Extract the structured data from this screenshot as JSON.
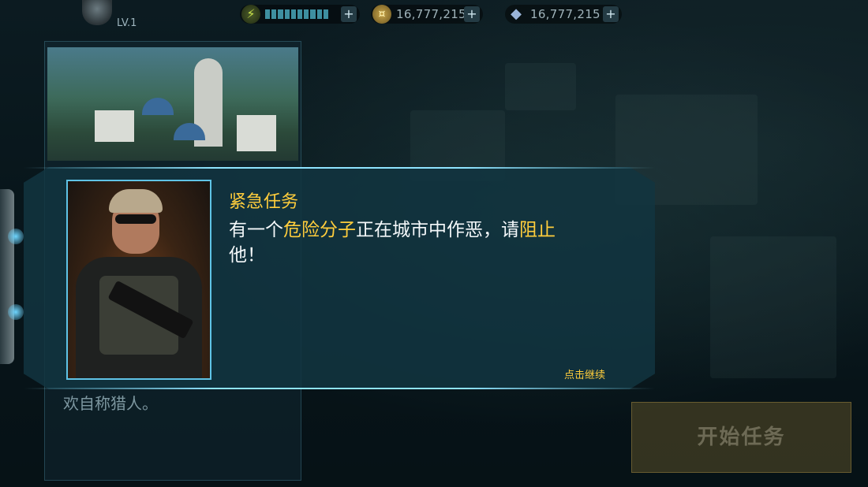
{
  "header": {
    "level": "LV.1",
    "energy_segments": 10,
    "coins": "16,777,215",
    "gems": "16,777,215",
    "icons": {
      "energy": "lightning-icon",
      "coins": "coin-icon",
      "gems": "diamond-icon",
      "add": "plus-icon"
    }
  },
  "story": {
    "last_line": "欢自称猎人。"
  },
  "dialog": {
    "title": "紧急任务",
    "message": {
      "p1": "有一个",
      "h1": "危险分子",
      "p2": "正在城市中作恶，请",
      "h2": "阻止",
      "p3": "他！"
    },
    "continue_hint": "点击继续"
  },
  "start_button": {
    "label": "开始任务"
  },
  "colors": {
    "accent_yellow": "#ffcd3c",
    "frame_cyan": "#8fe4ff",
    "panel": "#123440"
  }
}
